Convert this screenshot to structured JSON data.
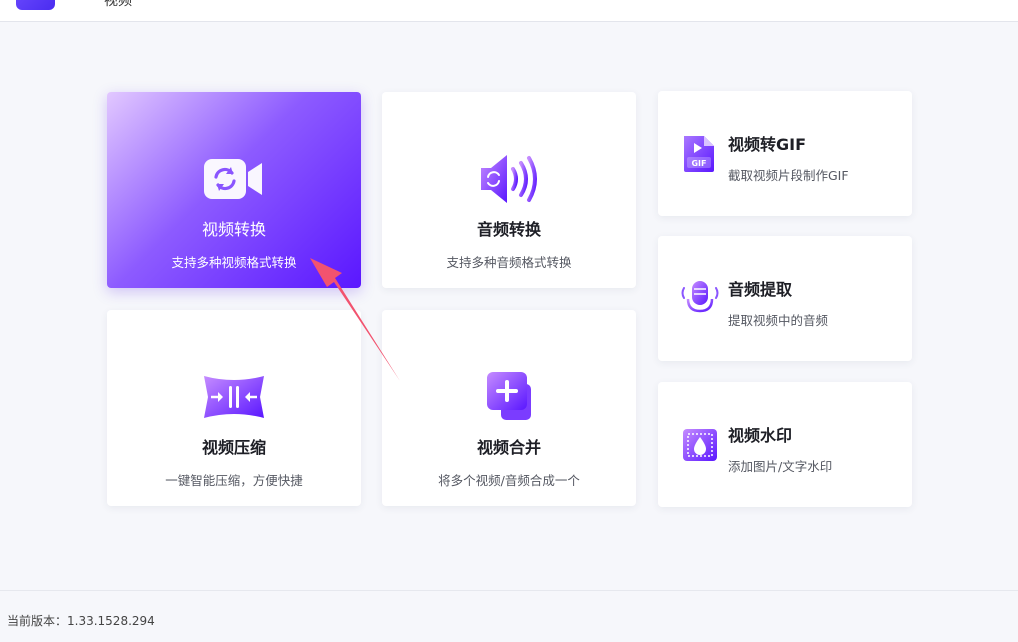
{
  "app": {
    "title": "视频"
  },
  "cards": {
    "video_convert": {
      "title": "视频转换",
      "desc": "支持多种视频格式转换",
      "icon": "video-convert-icon"
    },
    "audio_convert": {
      "title": "音频转换",
      "desc": "支持多种音频格式转换",
      "icon": "audio-convert-icon"
    },
    "video_gif": {
      "title": "视频转GIF",
      "desc": "截取视频片段制作GIF",
      "icon": "gif-file-icon"
    },
    "audio_extract": {
      "title": "音频提取",
      "desc": "提取视频中的音频",
      "icon": "microphone-icon"
    },
    "video_compress": {
      "title": "视频压缩",
      "desc": "一键智能压缩，方便快捷",
      "icon": "compress-icon"
    },
    "video_merge": {
      "title": "视频合并",
      "desc": "将多个视频/音频合成一个",
      "icon": "merge-plus-icon"
    },
    "video_watermark": {
      "title": "视频水印",
      "desc": "添加图片/文字水印",
      "icon": "watermark-icon"
    }
  },
  "footer": {
    "version": "当前版本：1.33.1528.294"
  },
  "colors": {
    "accent": "#6a2bff",
    "accent_light": "#c79bff",
    "arrow": "#f2536f",
    "background": "#f6f7fb"
  }
}
